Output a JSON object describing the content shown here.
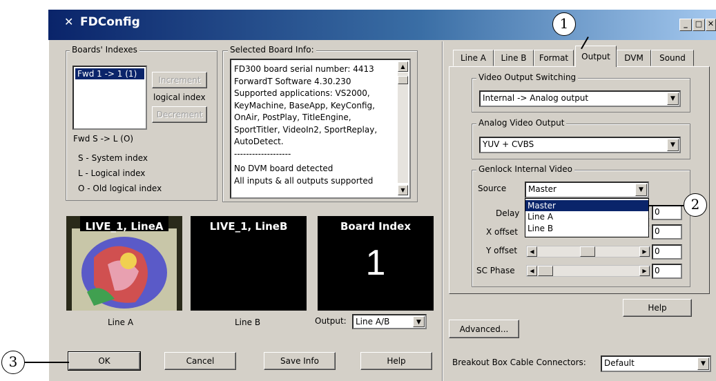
{
  "window": {
    "title": "FDConfig"
  },
  "boards": {
    "group_label": "Boards' Indexes",
    "list_items": [
      "Fwd 1 -> 1 (1)"
    ],
    "increment_label": "Increment",
    "logical_index_label": "logical index",
    "decrement_label": "Decrement",
    "formula": "Fwd S -> L (O)",
    "legend": [
      "S - System index",
      "L - Logical index",
      "O - Old logical index"
    ]
  },
  "info": {
    "group_label": "Selected Board Info:",
    "lines": [
      "FD300 board serial number: 4413",
      "ForwardT Software 4.30.230",
      "Supported applications: VS2000,",
      "KeyMachine, BaseApp, KeyConfig,",
      "OnAir, PostPlay, TitleEngine,",
      "SportTitler, VideoIn2, SportReplay,",
      "AutoDetect.",
      "-------------------",
      "No DVM board detected",
      "All inputs & all outputs supported"
    ]
  },
  "monitors": {
    "a_title": "LIVE_1, LineA",
    "a_caption": "Line A",
    "b_title": "LIVE_1, LineB",
    "b_caption": "Line B",
    "c_title": "Board Index",
    "c_value": "1",
    "output_label": "Output:",
    "output_value": "Line A/B"
  },
  "bottom_buttons": {
    "ok": "OK",
    "cancel": "Cancel",
    "save_info": "Save Info",
    "help": "Help"
  },
  "tabs": [
    "Line A",
    "Line B",
    "Format",
    "Output",
    "DVM",
    "Sound"
  ],
  "output_tab": {
    "switching_label": "Video Output Switching",
    "switching_value": "Internal -> Analog output",
    "analog_label": "Analog Video Output",
    "analog_value": "YUV + CVBS",
    "genlock_label": "Genlock Internal Video",
    "source_label": "Source",
    "source_value": "Master",
    "source_options": [
      "Master",
      "Line A",
      "Line B"
    ],
    "delay_label": "Delay",
    "xoffset_label": "X offset",
    "yoffset_label": "Y offset",
    "scphase_label": "SC Phase",
    "delay_value": "0",
    "xoffset_value": "0",
    "yoffset_value": "0",
    "scphase_value": "0",
    "help_label": "Help"
  },
  "advanced_label": "Advanced...",
  "breakout": {
    "label": "Breakout Box Cable Connectors:",
    "value": "Default"
  },
  "callouts": [
    "1",
    "2",
    "3"
  ]
}
